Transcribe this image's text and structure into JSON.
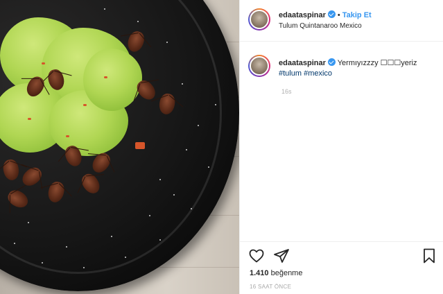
{
  "header": {
    "username": "edaataspinar",
    "follow_label": "Takip Et",
    "separator": "•",
    "location": "Tulum Quintanaroo Mexico"
  },
  "caption": {
    "username": "edaataspinar",
    "text": "Yermıyızzzy ☐☐☐yeriz",
    "hashtag1": "#tulum",
    "hashtag2": "#mexico",
    "age": "16s"
  },
  "actions": {
    "likes_count": "1.410",
    "likes_label": "beğenme",
    "post_time": "16 SAAT ÖNCE"
  },
  "icons": {
    "like": "heart-icon",
    "share": "paper-plane-icon",
    "save": "bookmark-icon",
    "verified": "verified-badge-icon"
  },
  "colors": {
    "link_blue": "#3897f0",
    "hashtag": "#00376b",
    "text": "#262626",
    "muted": "#a8a8a8"
  }
}
